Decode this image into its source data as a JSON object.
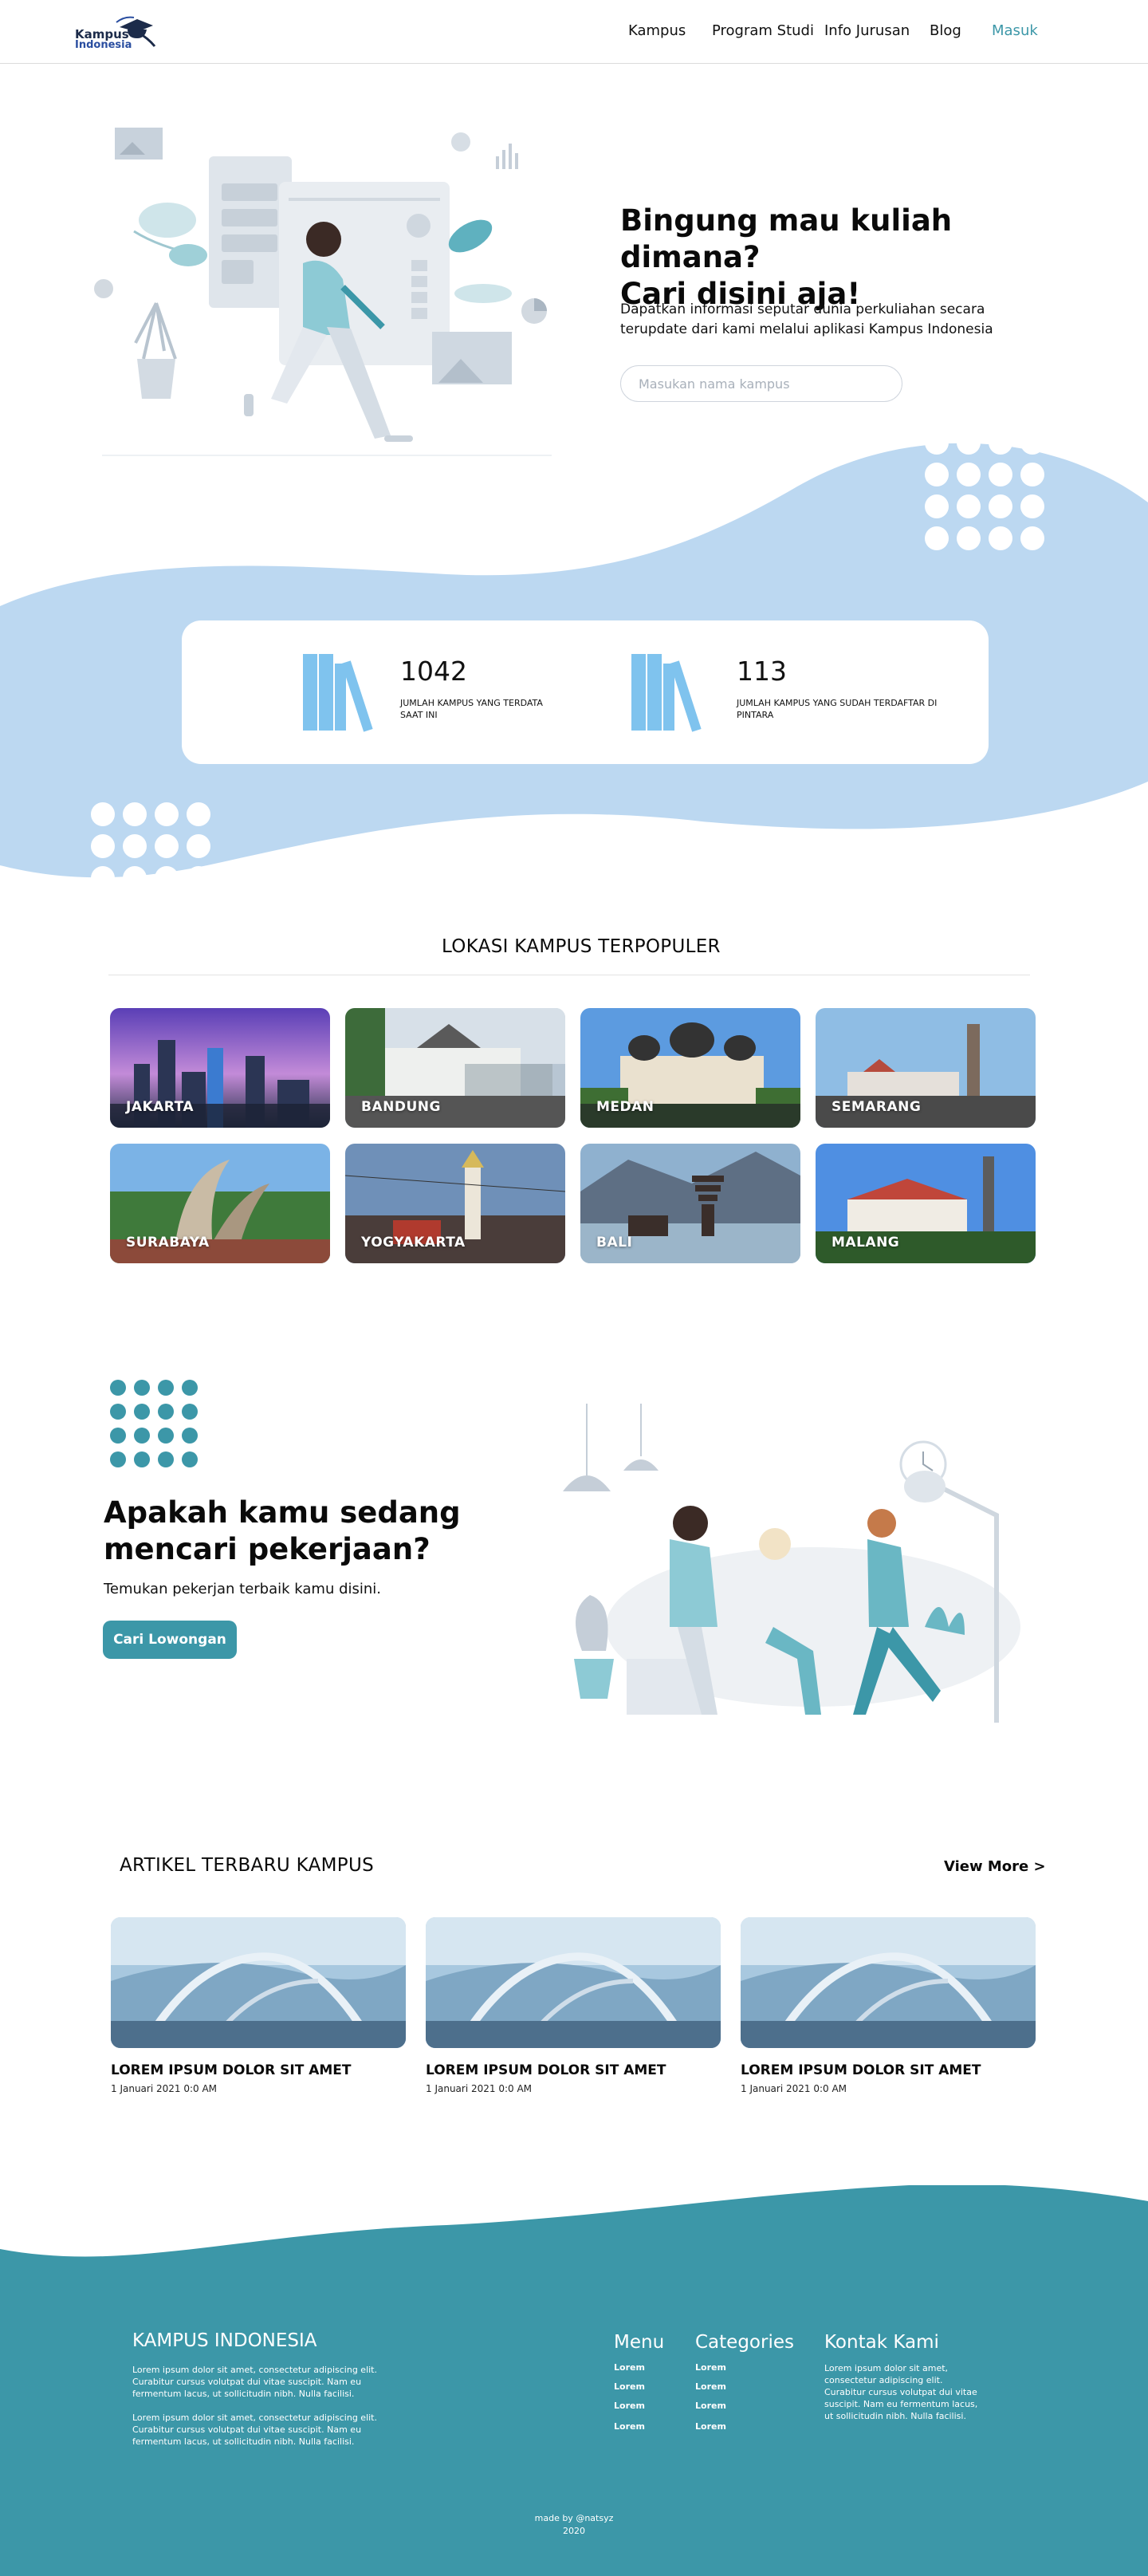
{
  "nav": {
    "logo_line1": "Kampus",
    "logo_line2": "Indonesia",
    "links": [
      "Kampus",
      "Program Studi",
      "Info Jurusan",
      "Blog"
    ],
    "login": "Masuk"
  },
  "hero": {
    "title_line1": "Bingung mau kuliah dimana?",
    "title_line2": "Cari disini aja!",
    "desc_line1": "Dapatkan informasi seputar dunia perkuliahan secara",
    "desc_line2": "terupdate dari kami melalui aplikasi Kampus Indonesia",
    "search_placeholder": "Masukan nama kampus"
  },
  "stats": [
    {
      "value": "1042",
      "label": "JUMLAH KAMPUS YANG TERDATA SAAT INI"
    },
    {
      "value": "113",
      "label": "JUMLAH KAMPUS YANG SUDAH TERDAFTAR DI PINTARA"
    }
  ],
  "locations": {
    "title": "LOKASI KAMPUS TERPOPULER",
    "items": [
      "JAKARTA",
      "BANDUNG",
      "MEDAN",
      "SEMARANG",
      "SURABAYA",
      "YOGYAKARTA",
      "BALI",
      "MALANG"
    ]
  },
  "job": {
    "title_line1": "Apakah kamu sedang",
    "title_line2": "mencari pekerjaan?",
    "desc": "Temukan pekerjan terbaik kamu disini.",
    "button": "Cari Lowongan"
  },
  "articles": {
    "title": "ARTIKEL TERBARU KAMPUS",
    "view_more": "View More >",
    "items": [
      {
        "title": "LOREM IPSUM DOLOR SIT AMET",
        "date": "1 Januari 2021 0:0 AM"
      },
      {
        "title": "LOREM IPSUM DOLOR SIT AMET",
        "date": "1 Januari 2021 0:0 AM"
      },
      {
        "title": "LOREM IPSUM DOLOR SIT AMET",
        "date": "1 Januari 2021 0:0 AM"
      }
    ]
  },
  "footer": {
    "brand": "KAMPUS INDONESIA",
    "para1": "Lorem ipsum dolor sit amet, consectetur adipiscing elit. Curabitur cursus volutpat dui vitae suscipit. Nam eu fermentum lacus, ut sollicitudin nibh. Nulla facilisi.",
    "para2": "Lorem ipsum dolor sit amet, consectetur adipiscing elit. Curabitur cursus volutpat dui vitae suscipit. Nam eu fermentum lacus, ut sollicitudin nibh. Nulla facilisi.",
    "menu_title": "Menu",
    "menu_links": [
      "Lorem",
      "Lorem",
      "Lorem",
      "Lorem"
    ],
    "categories_title": "Categories",
    "categories_links": [
      "Lorem",
      "Lorem",
      "Lorem",
      "Lorem"
    ],
    "contact_title": "Kontak Kami",
    "contact_text": "Lorem ipsum dolor sit amet, consectetur adipiscing elit. Curabitur cursus volutpat dui vitae suscipit. Nam eu fermentum lacus, ut sollicitudin nibh. Nulla facilisi.",
    "credit_line1": "made by @natsyz",
    "credit_line2": "2020"
  },
  "colors": {
    "accent": "#3c97a8",
    "light_blue": "#bcd8f1",
    "footer_bg": "#3c97a8",
    "book_blue": "#7fc3ee"
  },
  "icons": [
    "graduation-cap-icon",
    "books-icon"
  ]
}
